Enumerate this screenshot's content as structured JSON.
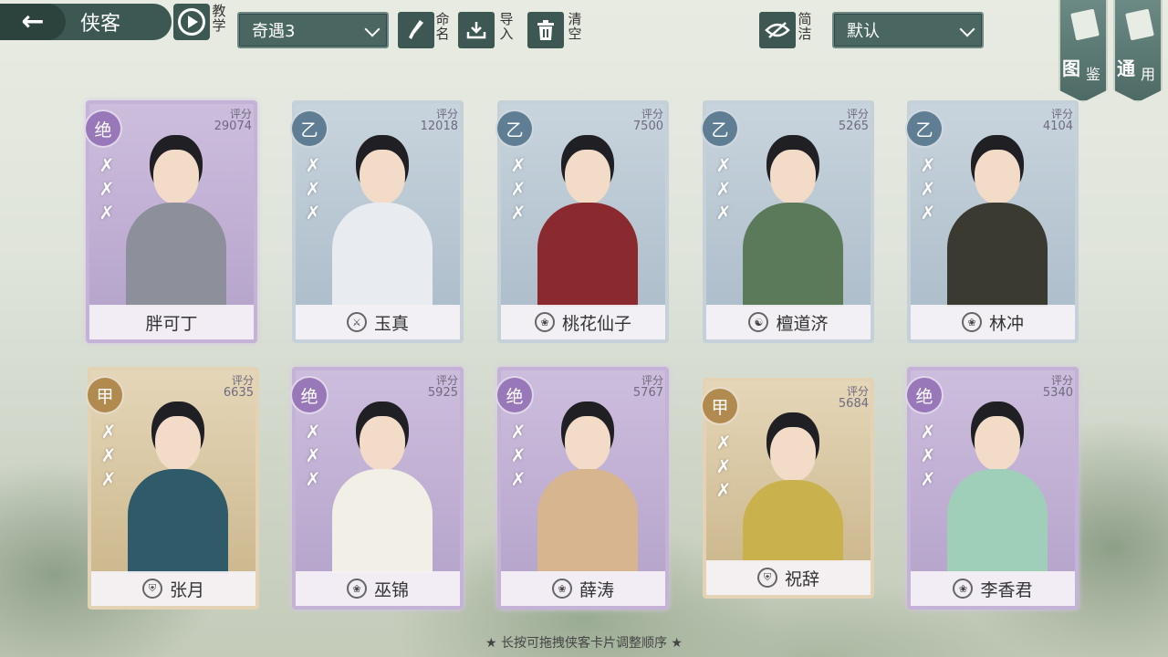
{
  "header": {
    "title": "侠客",
    "tutorial_label": "教学",
    "team_select": "奇遇3",
    "rename_label": "命名",
    "import_label": "导入",
    "clear_label": "清空",
    "simple_label": "简洁",
    "sort_select": "默认",
    "atlas_label_1": "图",
    "atlas_label_2": "鉴",
    "general_label_1": "通",
    "general_label_2": "用"
  },
  "score_label": "评分",
  "cards": [
    {
      "name": "胖可丁",
      "rank": "绝",
      "score": "29074",
      "tier": "purple",
      "swords": "✗✗✗",
      "name_icon": ""
    },
    {
      "name": "玉真",
      "rank": "乙",
      "score": "12018",
      "tier": "blue",
      "swords": "✗✗✗",
      "name_icon": "sword-icon"
    },
    {
      "name": "桃花仙子",
      "rank": "乙",
      "score": "7500",
      "tier": "blue",
      "swords": "✗✗✗",
      "name_icon": "lotus-icon"
    },
    {
      "name": "檀道济",
      "rank": "乙",
      "score": "5265",
      "tier": "blue",
      "swords": "✗✗✗",
      "name_icon": "taiji-icon"
    },
    {
      "name": "林冲",
      "rank": "乙",
      "score": "4104",
      "tier": "blue",
      "swords": "✗✗✗",
      "name_icon": "lotus-icon"
    },
    {
      "name": "张月",
      "rank": "甲",
      "score": "6635",
      "tier": "gold",
      "swords": "✗✗✗",
      "name_icon": "shield-icon"
    },
    {
      "name": "巫锦",
      "rank": "绝",
      "score": "5925",
      "tier": "purple",
      "swords": "✗✗✗",
      "name_icon": "lotus-icon"
    },
    {
      "name": "薛涛",
      "rank": "绝",
      "score": "5767",
      "tier": "purple",
      "swords": "✗✗✗",
      "name_icon": "lotus-icon"
    },
    {
      "name": "祝辞",
      "rank": "甲",
      "score": "5684",
      "tier": "gold",
      "swords": "✗✗✗",
      "name_icon": "shield-icon"
    },
    {
      "name": "李香君",
      "rank": "绝",
      "score": "5340",
      "tier": "purple",
      "swords": "✗✗✗",
      "name_icon": "lotus-icon"
    }
  ],
  "hint": "★  长按可拖拽侠客卡片调整顺序  ★"
}
